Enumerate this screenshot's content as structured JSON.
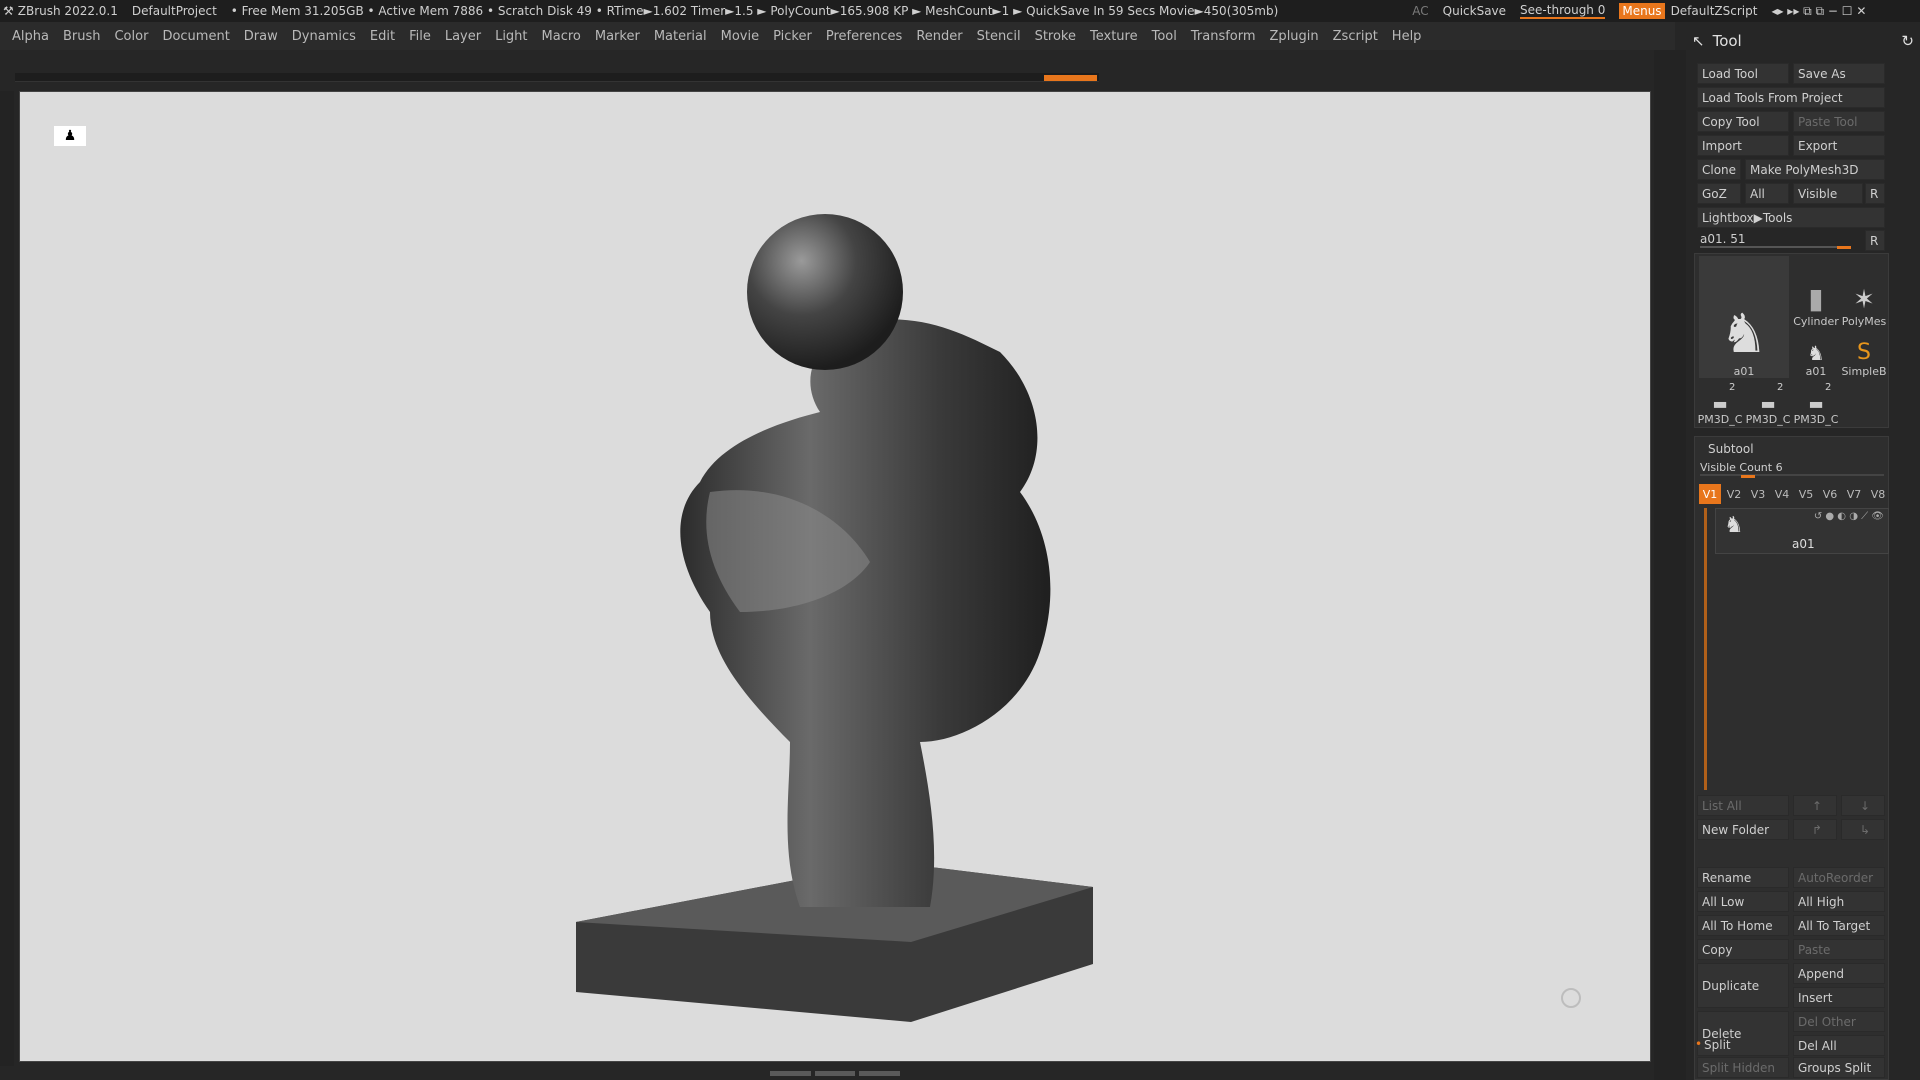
{
  "titlebar": {
    "app": "ZBrush 2022.0.1",
    "project": "DefaultProject",
    "stats": "• Free Mem 31.205GB • Active Mem 7886 • Scratch Disk 49 •  RTime►1.602 Timer►1.5 ► PolyCount►165.908 KP  ► MeshCount►1  ► QuickSave In 59 Secs Movie►450(305mb)",
    "ac": "AC",
    "quicksave": "QuickSave",
    "see_through": "See-through 0",
    "menus": "Menus",
    "script": "DefaultZScript"
  },
  "menubar": [
    "Alpha",
    "Brush",
    "Color",
    "Document",
    "Draw",
    "Dynamics",
    "Edit",
    "File",
    "Layer",
    "Light",
    "Macro",
    "Marker",
    "Material",
    "Movie",
    "Picker",
    "Preferences",
    "Render",
    "Stencil",
    "Stroke",
    "Texture",
    "Tool",
    "Transform",
    "Zplugin",
    "Zscript",
    "Help"
  ],
  "panel": {
    "title": "Tool",
    "buttons": {
      "load_tool": "Load Tool",
      "save_as": "Save As",
      "load_from_project": "Load Tools From Project",
      "copy_tool": "Copy Tool",
      "paste_tool": "Paste Tool",
      "import": "Import",
      "export": "Export",
      "clone": "Clone",
      "make_polymesh": "Make PolyMesh3D",
      "goz": "GoZ",
      "all": "All",
      "visible": "Visible",
      "r": "R",
      "lightbox": "Lightbox▶Tools"
    },
    "current_tool": "a01. 51",
    "thumbs": [
      "a01",
      "Cylinder",
      "PolyMes",
      "a01",
      "SimpleB",
      "PM3D_C",
      "PM3D_C",
      "PM3D_C"
    ],
    "thumb_badges": [
      "2",
      "2",
      "2"
    ],
    "subtool": {
      "title": "Subtool",
      "visible_count": "Visible Count 6",
      "versions": [
        "V1",
        "V2",
        "V3",
        "V4",
        "V5",
        "V6",
        "V7",
        "V8"
      ],
      "item": "a01"
    },
    "actions": {
      "list_all": "List All",
      "new_folder": "New Folder",
      "rename": "Rename",
      "autoreorder": "AutoReorder",
      "all_low": "All Low",
      "all_high": "All High",
      "all_to_home": "All To Home",
      "all_to_target": "All To Target",
      "copy": "Copy",
      "paste": "Paste",
      "duplicate": "Duplicate",
      "append": "Append",
      "insert": "Insert",
      "delete": "Delete",
      "del_other": "Del Other",
      "del_all": "Del All",
      "split": "Split",
      "split_hidden": "Split Hidden",
      "groups_split": "Groups Split"
    }
  },
  "colors": {
    "accent": "#e8761c",
    "canvas": "#dcdcdc"
  }
}
